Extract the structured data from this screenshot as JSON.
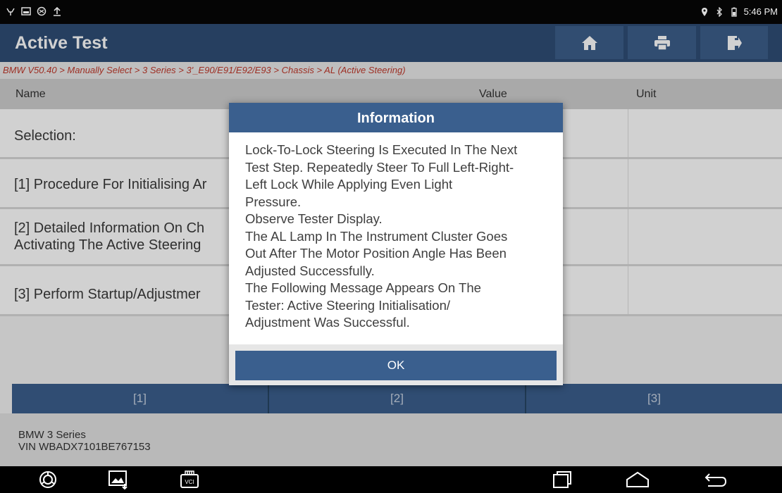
{
  "status_bar": {
    "time": "5:46 PM"
  },
  "header": {
    "title": "Active Test",
    "buttons": [
      "home-icon",
      "print-icon",
      "exit-icon"
    ]
  },
  "breadcrumb": "BMW V50.40 > Manually Select > 3 Series > 3'_E90/E91/E92/E93 > Chassis > AL (Active Steering)",
  "table": {
    "headers": {
      "name": "Name",
      "value": "Value",
      "unit": "Unit"
    },
    "rows": [
      {
        "name": "Selection:"
      },
      {
        "name": "[1] Procedure For Initialising Ar"
      },
      {
        "name_lines": [
          "[2] Detailed Information On Ch",
          "Activating The Active Steering"
        ]
      },
      {
        "name": "[3] Perform Startup/Adjustmer"
      }
    ]
  },
  "bottom_buttons": [
    "[1]",
    "[2]",
    "[3]"
  ],
  "vehicle": {
    "model": "BMW 3 Series",
    "vin": "VIN WBADX7101BE767153"
  },
  "dialog": {
    "title": "Information",
    "lines": [
      "Lock-To-Lock Steering Is Executed In The Next",
      "Test Step. Repeatedly Steer To Full Left-Right-",
      "Left Lock While Applying Even Light",
      "Pressure.",
      "Observe Tester Display.",
      "The AL Lamp In The Instrument Cluster Goes",
      "Out After The Motor Position Angle Has Been",
      "Adjusted Successfully.",
      "The Following Message Appears On The",
      "Tester: Active Steering Initialisation/",
      "Adjustment Was Successful."
    ],
    "ok_label": "OK"
  },
  "nav_bar": {
    "icons": [
      "browser-icon",
      "gallery-icon",
      "vci-icon",
      "recent-apps-icon",
      "home-nav-icon",
      "back-icon"
    ],
    "vci_label": "VCI"
  },
  "colors": {
    "header_bg": "#2f4e76",
    "button_bg": "#3b5f8d",
    "breadcrumb_text": "#c0392b"
  }
}
